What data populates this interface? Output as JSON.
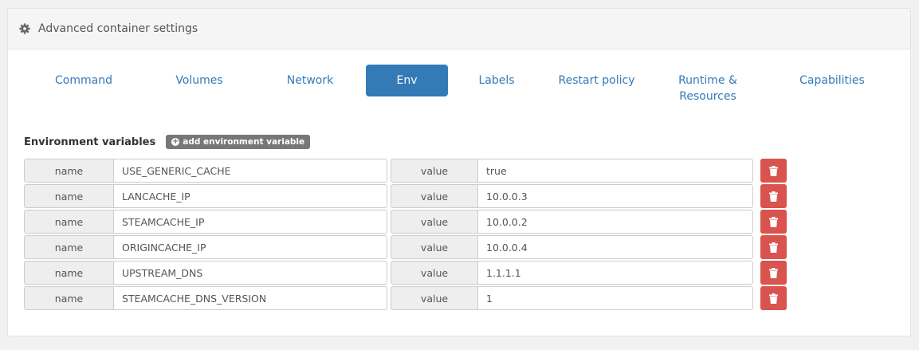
{
  "panel": {
    "title": "Advanced container settings"
  },
  "tabs": [
    {
      "label": "Command"
    },
    {
      "label": "Volumes"
    },
    {
      "label": "Network"
    },
    {
      "label": "Env"
    },
    {
      "label": "Labels"
    },
    {
      "label": "Restart policy"
    },
    {
      "label": "Runtime & Resources"
    },
    {
      "label": "Capabilities"
    }
  ],
  "active_tab": "Env",
  "env": {
    "title": "Environment variables",
    "add_label": "add environment variable",
    "name_addon": "name",
    "value_addon": "value",
    "variables": [
      {
        "name": "USE_GENERIC_CACHE",
        "value": "true"
      },
      {
        "name": "LANCACHE_IP",
        "value": "10.0.0.3"
      },
      {
        "name": "STEAMCACHE_IP",
        "value": "10.0.0.2"
      },
      {
        "name": "ORIGINCACHE_IP",
        "value": "10.0.0.4"
      },
      {
        "name": "UPSTREAM_DNS",
        "value": "1.1.1.1"
      },
      {
        "name": "STEAMCACHE_DNS_VERSION",
        "value": "1"
      }
    ]
  },
  "colors": {
    "primary": "#337ab7",
    "danger": "#d9534f"
  }
}
